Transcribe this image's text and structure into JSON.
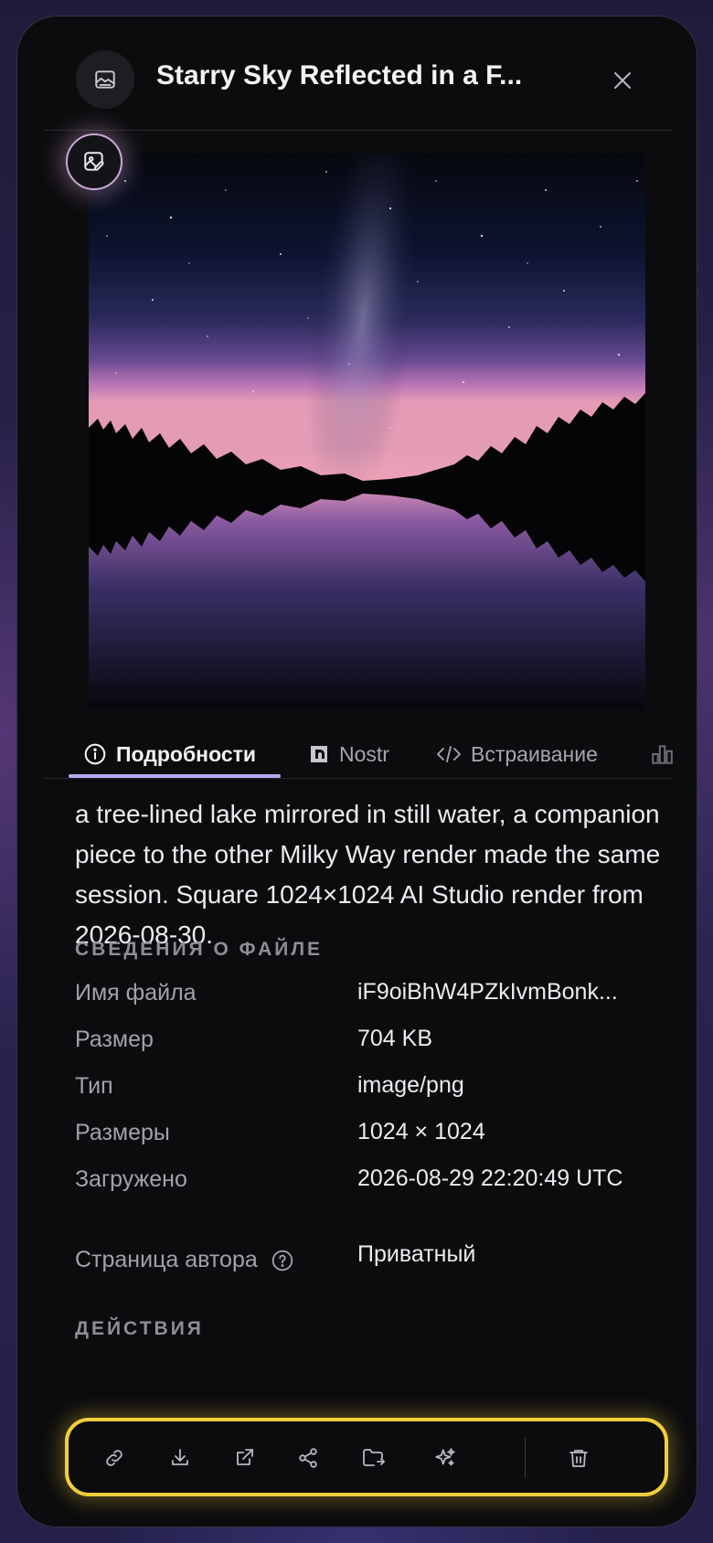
{
  "header": {
    "title": "Starry Sky Reflected in a F...",
    "icon": "image-icon",
    "close_icon": "close-icon"
  },
  "image": {
    "alt": "Starry sky with Milky Way over a tree-lined lake reflected in still water"
  },
  "tabs": [
    {
      "label": "Подробности",
      "icon": "info-icon",
      "active": true
    },
    {
      "label": "Nostr",
      "icon": "nostr-icon",
      "active": false
    },
    {
      "label": "Встраивание",
      "icon": "code-icon",
      "active": false
    },
    {
      "label": "",
      "icon": "stats-icon",
      "active": false
    }
  ],
  "description": "a tree-lined lake mirrored in still water, a companion piece to the other Milky Way render made the same session. Square 1024×1024 AI Studio render from 2026-08-30.",
  "file_info": {
    "heading": "СВЕДЕНИЯ О ФАЙЛЕ",
    "rows": [
      {
        "label": "Имя файла",
        "value": "iF9oiBhW4PZkIvmBonk..."
      },
      {
        "label": "Размер",
        "value": "704 KB"
      },
      {
        "label": "Тип",
        "value": "image/png"
      },
      {
        "label": "Размеры",
        "value": "1024 × 1024"
      },
      {
        "label": "Загружено",
        "value": "2026-08-29 22:20:49 UTC"
      },
      {
        "label": "Страница автора",
        "value": "Приватный"
      }
    ]
  },
  "actions": {
    "heading": "ДЕЙСТВИЯ",
    "buttons": [
      "link-icon",
      "download-icon",
      "external-link-icon",
      "share-icon",
      "move-folder-icon",
      "sparkles-icon",
      "trash-icon"
    ]
  },
  "colors": {
    "accent": "#b9a6f2",
    "highlight": "#f3cd3c",
    "background": "#0c0c0e"
  }
}
